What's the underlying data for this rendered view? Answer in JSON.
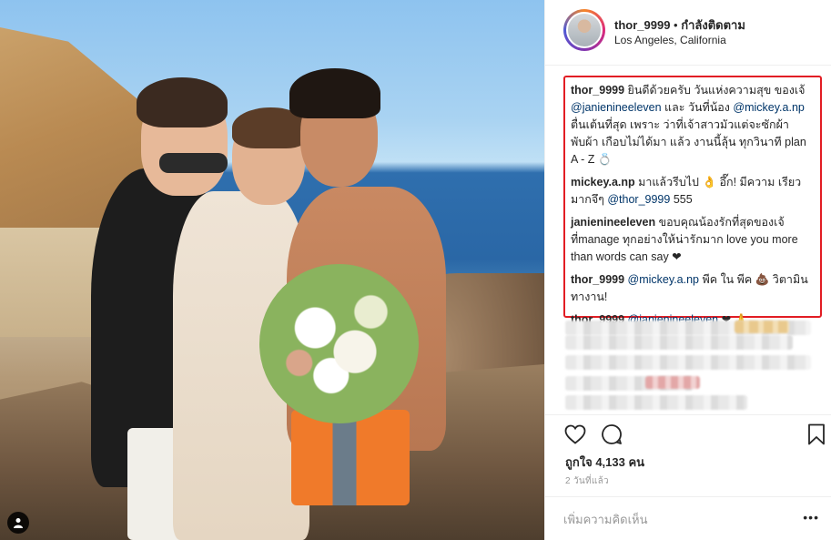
{
  "post": {
    "username": "thor_9999",
    "separator": " • ",
    "follow_status": "กำลังติดตาม",
    "location": "Los Angeles, California"
  },
  "comments": [
    {
      "user": "thor_9999",
      "parts": [
        " ยินดีด้วยครับ วันแห่งความสุข ของเจ้ ",
        {
          "m": "@janienineeleven"
        },
        " และ วันที่น้อง ",
        {
          "m": "@mickey.a.np"
        },
        " ตื่นเต้นที่สุด เพราะ ว่าที่เจ้าสาวมัวแต่จะซักผ้าพับผ้า เกือบไม่ได้มา แล้ว งานนี้ลุ้น ทุกวินาที plan A - Z 💍"
      ]
    },
    {
      "user": "mickey.a.np",
      "parts": [
        " มาแล้วรีบไป 👌 อึ๊ก! มีความ เรียวมากจึๆ ",
        {
          "m": "@thor_9999"
        },
        " 555"
      ]
    },
    {
      "user": "janienineeleven",
      "parts": [
        " ขอบคุณน้องรักที่สุดของเจ้ที่manage ทุกอย่างให้น่ารักมาก love you more than words can say ❤"
      ]
    },
    {
      "user": "thor_9999",
      "parts": [
        " ",
        {
          "m": "@mickey.a.np"
        },
        " พีค ใน พีค 💩 วิตามิน ทางาน!"
      ]
    },
    {
      "user": "thor_9999",
      "parts": [
        " ",
        {
          "m": "@janienineeleven"
        },
        " ❤ 🙏"
      ]
    }
  ],
  "actions": {
    "like_icon": "heart-outline-icon",
    "comment_icon": "speech-bubble-icon",
    "save_icon": "bookmark-icon"
  },
  "likes_text": "ถูกใจ 4,133 คน",
  "time_text": "2 วันที่แล้ว",
  "comment_input": {
    "placeholder": "เพิ่มความคิดเห็น"
  },
  "more_label": "•••",
  "colors": {
    "highlight_box": "#e21d24",
    "mention": "#003569"
  }
}
